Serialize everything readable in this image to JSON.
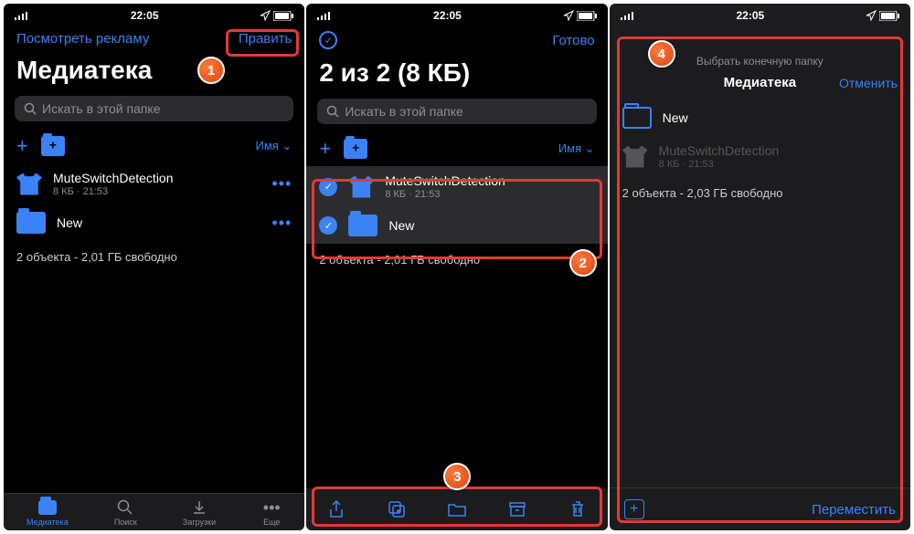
{
  "status": {
    "time": "22:05"
  },
  "screen1": {
    "nav": {
      "left": "Посмотреть рекламу",
      "right": "Править"
    },
    "title": "Медиатека",
    "search_placeholder": "Искать в этой папке",
    "sort": "Имя ⌄",
    "items": [
      {
        "name": "MuteSwitchDetection",
        "meta": "8 КБ · 21:53",
        "type": "file"
      },
      {
        "name": "New",
        "meta": "",
        "type": "folder"
      }
    ],
    "footer": "2 объекта  -  2,01 ГБ свободно",
    "tabs": [
      {
        "label": "Медиатека",
        "active": true
      },
      {
        "label": "Поиск"
      },
      {
        "label": "Загрузки"
      },
      {
        "label": "Еще"
      }
    ]
  },
  "screen2": {
    "nav": {
      "right": "Готово"
    },
    "title": "2 из 2 (8 КБ)",
    "search_placeholder": "Искать в этой папке",
    "sort": "Имя ⌄",
    "items": [
      {
        "name": "MuteSwitchDetection",
        "meta": "8 КБ · 21:53",
        "type": "file"
      },
      {
        "name": "New",
        "meta": "",
        "type": "folder"
      }
    ],
    "footer": "2 объекта  -  2,01 ГБ свободно"
  },
  "screen3": {
    "head": "Выбрать конечную папку",
    "title": "Медиатека",
    "cancel": "Отменить",
    "items": [
      {
        "name": "New",
        "meta": "",
        "type": "folder"
      },
      {
        "name": "MuteSwitchDetection",
        "meta": "8 КБ · 21:53",
        "type": "file"
      }
    ],
    "footer": "2 объекта  -  2,03 ГБ свободно",
    "move": "Переместить"
  },
  "callouts": {
    "c1": "1",
    "c2": "2",
    "c3": "3",
    "c4": "4"
  }
}
